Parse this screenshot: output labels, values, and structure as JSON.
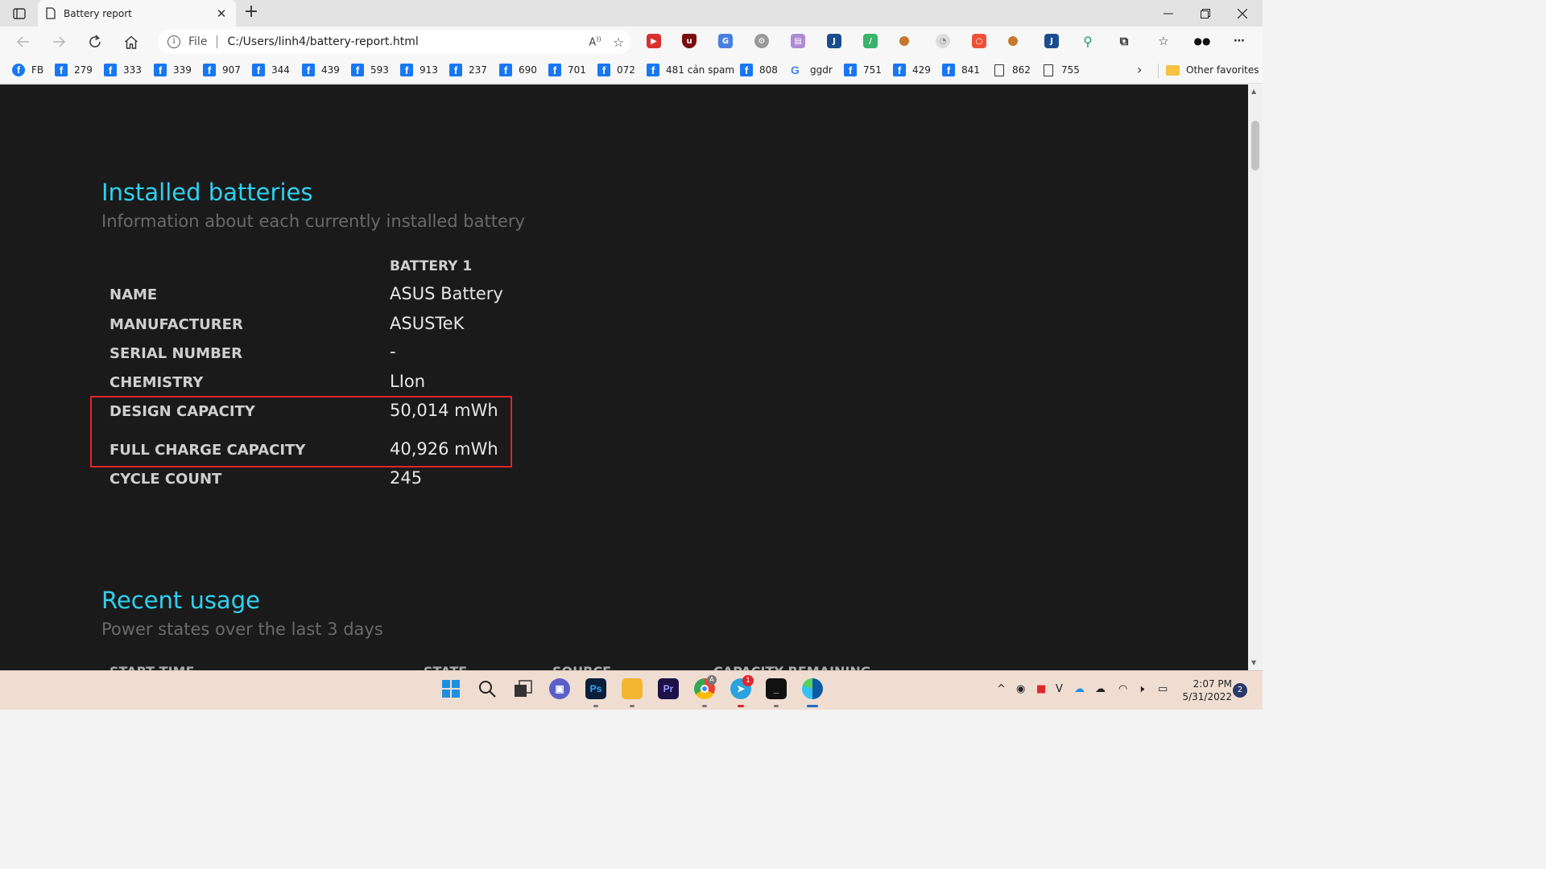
{
  "browser": {
    "tab": {
      "title": "Battery report"
    },
    "address": {
      "scheme": "File",
      "url": "C:/Users/linh4/battery-report.html"
    }
  },
  "bookmarks": {
    "items": [
      {
        "label": "FB",
        "icon": "facebook-round-icon"
      },
      {
        "label": "279",
        "icon": "facebook-icon"
      },
      {
        "label": "333",
        "icon": "facebook-icon"
      },
      {
        "label": "339",
        "icon": "facebook-icon"
      },
      {
        "label": "907",
        "icon": "facebook-icon"
      },
      {
        "label": "344",
        "icon": "facebook-icon"
      },
      {
        "label": "439",
        "icon": "facebook-icon"
      },
      {
        "label": "593",
        "icon": "facebook-icon"
      },
      {
        "label": "913",
        "icon": "facebook-icon"
      },
      {
        "label": "237",
        "icon": "facebook-icon"
      },
      {
        "label": "690",
        "icon": "facebook-icon"
      },
      {
        "label": "701",
        "icon": "facebook-icon"
      },
      {
        "label": "072",
        "icon": "facebook-icon"
      },
      {
        "label": "481 cản spam",
        "icon": "facebook-icon"
      },
      {
        "label": "808",
        "icon": "facebook-icon"
      },
      {
        "label": "ggdr",
        "icon": "google-icon"
      },
      {
        "label": "751",
        "icon": "facebook-icon"
      },
      {
        "label": "429",
        "icon": "facebook-icon"
      },
      {
        "label": "841",
        "icon": "facebook-icon"
      },
      {
        "label": "862",
        "icon": "document-icon"
      },
      {
        "label": "755",
        "icon": "document-icon"
      }
    ],
    "other_favorites": "Other favorites"
  },
  "report": {
    "installed": {
      "title": "Installed batteries",
      "subtitle": "Information about each currently installed battery",
      "column_header": "BATTERY 1",
      "rows": [
        {
          "label": "NAME",
          "value": "ASUS Battery"
        },
        {
          "label": "MANUFACTURER",
          "value": "ASUSTeK"
        },
        {
          "label": "SERIAL NUMBER",
          "value": "-"
        },
        {
          "label": "CHEMISTRY",
          "value": "LIon"
        },
        {
          "label": "DESIGN CAPACITY",
          "value": "50,014 mWh"
        },
        {
          "label": "FULL CHARGE CAPACITY",
          "value": "40,926 mWh"
        },
        {
          "label": "CYCLE COUNT",
          "value": "245"
        }
      ]
    },
    "recent": {
      "title": "Recent usage",
      "subtitle": "Power states over the last 3 days",
      "columns": [
        "START TIME",
        "STATE",
        "SOURCE",
        "CAPACITY REMAINING"
      ]
    }
  },
  "taskbar": {
    "telegram_badge": "1",
    "chrome_badge": "A",
    "clock_time": "2:07 PM",
    "clock_date": "5/31/2022",
    "notification_count": "2"
  },
  "colors": {
    "accent_title": "#2fd1f0",
    "highlight_border": "#e0252b",
    "content_bg": "#1a1a1a"
  }
}
